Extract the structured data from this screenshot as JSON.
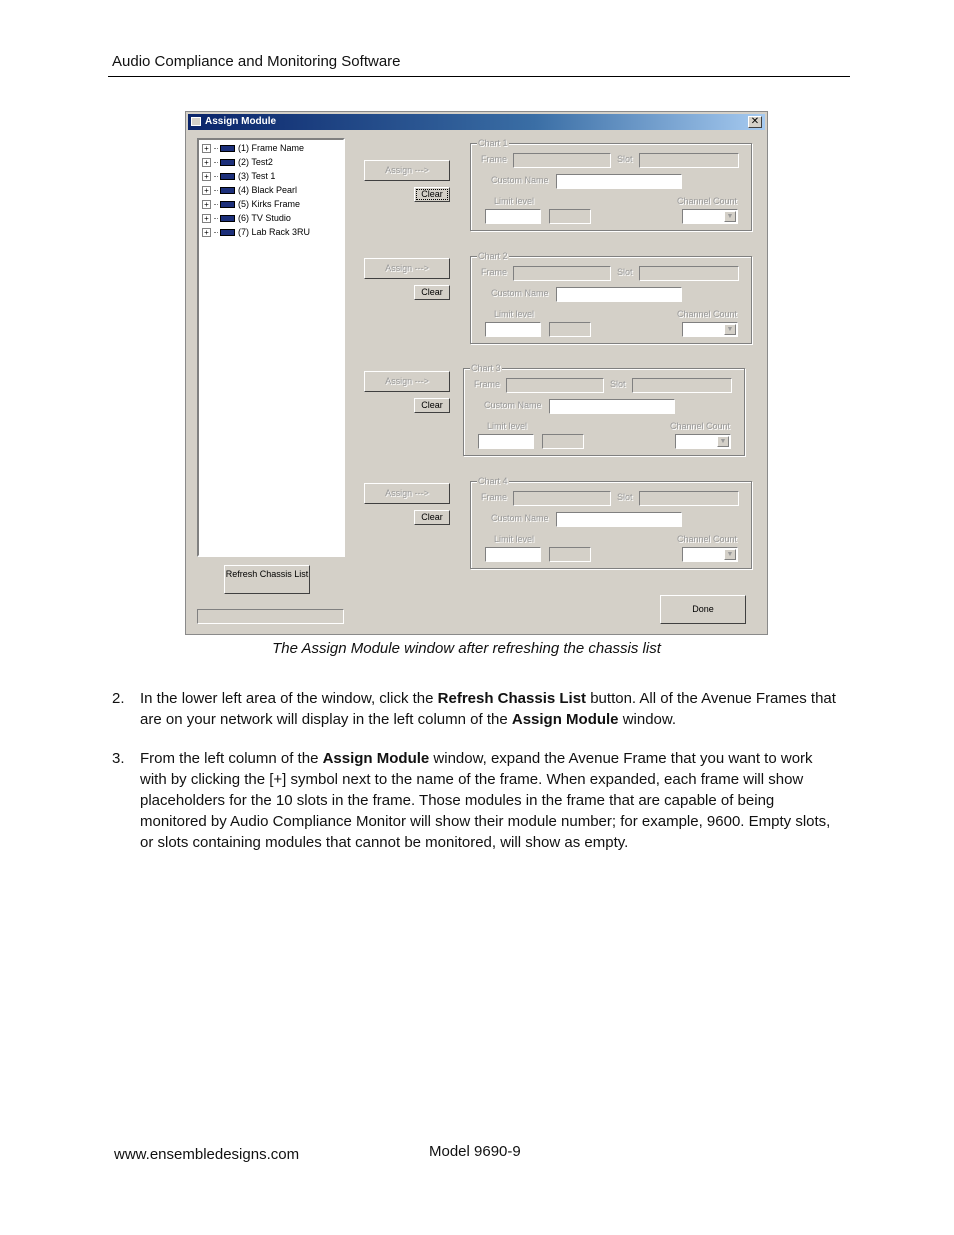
{
  "header": {
    "title": "Audio Compliance and Monitoring Software"
  },
  "window": {
    "title": "Assign Module",
    "close_glyph": "✕",
    "tree_items": [
      "(1) Frame Name",
      "(2) Test2",
      "(3) Test 1",
      "(4) Black Pearl",
      "(5) Kirks Frame",
      "(6) TV Studio",
      "(7) Lab Rack 3RU"
    ],
    "assign_label": "Assign --->",
    "clear_label": "Clear",
    "charts": [
      {
        "legend": "Chart 1"
      },
      {
        "legend": "Chart 2"
      },
      {
        "legend": "Chart 3"
      },
      {
        "legend": "Chart 4"
      }
    ],
    "field_labels": {
      "frame": "Frame",
      "slot": "Slot",
      "custom_name": "Custom Name",
      "limit_level": "Limit level",
      "channel_count": "Channel Count"
    },
    "refresh_label": "Refresh Chassis List",
    "done_label": "Done"
  },
  "caption": "The Assign Module window after refreshing the chassis list",
  "steps": [
    {
      "num": "2.",
      "t1": "In the lower left area of the window, click the ",
      "b1": "Refresh Chassis List",
      "t2": " button. All of the Avenue Frames that are on your network will display in the left column of the ",
      "b2": "Assign Module",
      "t3": " window."
    },
    {
      "num": "3.",
      "t1": "From the left column of the ",
      "b1": "Assign Module",
      "t2": " window, expand the Avenue Frame that you want to work with by clicking the [+] symbol next to the name of the frame. When expanded, each frame will show placeholders for the 10 slots in the frame. Those modules in the frame that are capable of being monitored by Audio Compliance Monitor will show their module number; for example, 9600. Empty slots, or slots containing modules that cannot be monitored, will show as empty."
    }
  ],
  "footer": {
    "website": "www.ensembledesigns.com",
    "model": "Model 9690-9"
  }
}
